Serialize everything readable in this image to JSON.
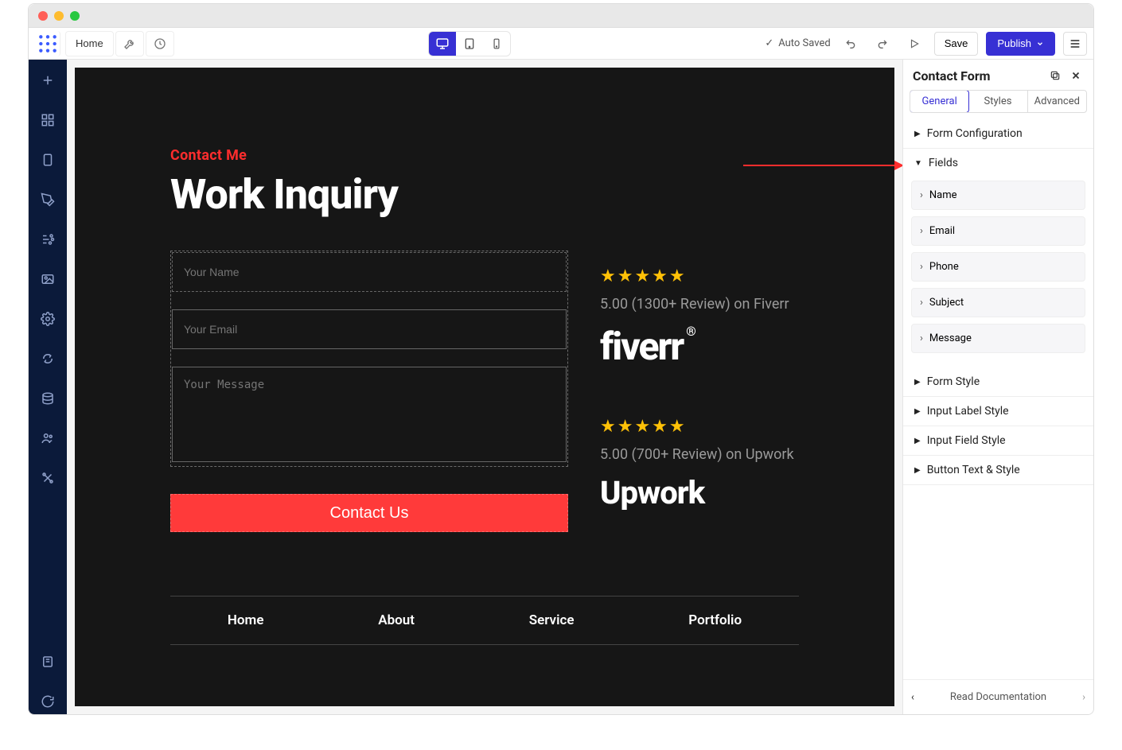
{
  "toolbar": {
    "home_label": "Home",
    "auto_saved": "Auto Saved",
    "save_label": "Save",
    "publish_label": "Publish"
  },
  "canvas": {
    "section_label": "Contact Me",
    "heading": "Work Inquiry",
    "form": {
      "name_placeholder": "Your Name",
      "email_placeholder": "Your Email",
      "message_placeholder": "Your Message",
      "submit_label": "Contact Us"
    },
    "reviews": {
      "fiverr_stars": "★★★★★",
      "fiverr_text": "5.00 (1300+ Review) on Fiverr",
      "fiverr_brand": "fiverr",
      "upwork_stars": "★★★★★",
      "upwork_text": "5.00 (700+ Review) on Upwork",
      "upwork_brand": "Upwork"
    },
    "nav": [
      "Home",
      "About",
      "Service",
      "Portfolio"
    ]
  },
  "rightpanel": {
    "title": "Contact Form",
    "tabs": [
      "General",
      "Styles",
      "Advanced"
    ],
    "accordions": {
      "form_configuration": "Form Configuration",
      "fields": "Fields",
      "form_style": "Form Style",
      "input_label_style": "Input Label Style",
      "input_field_style": "Input Field Style",
      "button_text_style": "Button Text & Style"
    },
    "fields": [
      "Name",
      "Email",
      "Phone",
      "Subject",
      "Message"
    ],
    "footer_link": "Read Documentation"
  }
}
